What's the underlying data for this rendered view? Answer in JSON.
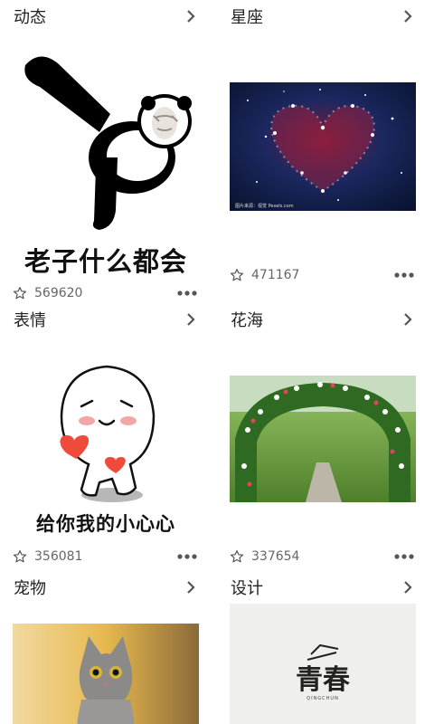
{
  "categories": [
    {
      "title": "动态",
      "count": "569620",
      "caption": "老子什么都会"
    },
    {
      "title": "星座",
      "count": "471167",
      "credit": "图片来源：视觉 Pexels.com"
    },
    {
      "title": "表情",
      "count": "356081",
      "caption": "给你我的小心心"
    },
    {
      "title": "花海",
      "count": "337654"
    },
    {
      "title": "宠物"
    },
    {
      "title": "设计",
      "logo_text": "青春",
      "logo_sub": "QINGCHUN"
    }
  ],
  "icons": {
    "chevron": "chevron-right-icon",
    "star": "star-outline-icon",
    "more": "more-dots-icon"
  },
  "colors": {
    "text": "#222222",
    "muted": "#666666",
    "icon": "#555555"
  }
}
